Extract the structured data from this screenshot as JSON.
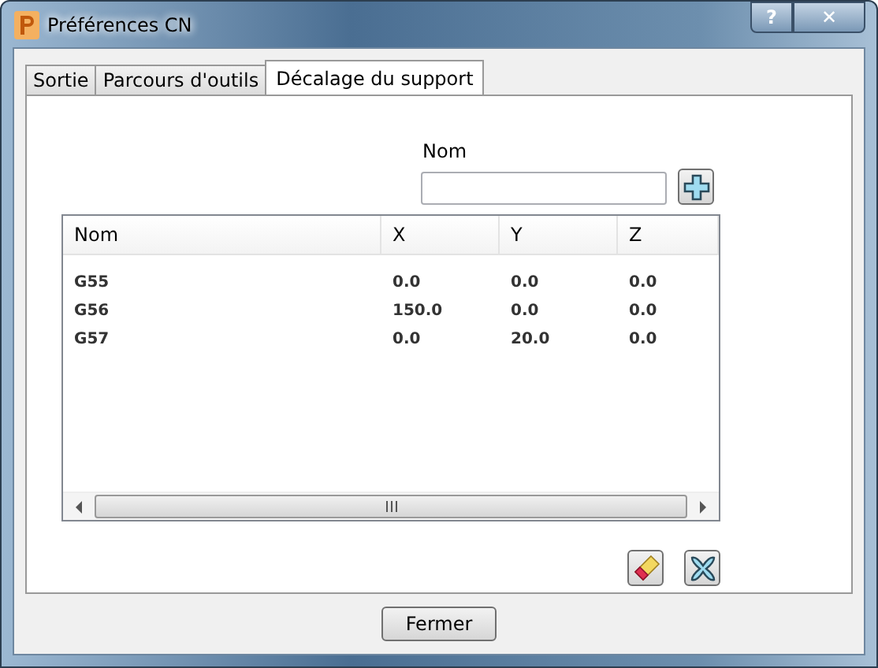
{
  "window": {
    "title": "Préférences CN",
    "help": "?",
    "close": "✕"
  },
  "tabs": [
    {
      "label": "Sortie",
      "selected": false
    },
    {
      "label": "Parcours d'outils",
      "selected": false
    },
    {
      "label": "Décalage du support",
      "selected": true
    }
  ],
  "name_field": {
    "label": "Nom"
  },
  "table": {
    "columns": [
      "Nom",
      "X",
      "Y",
      "Z"
    ],
    "rows": [
      [
        "G55",
        "0.0",
        "0.0",
        "0.0"
      ],
      [
        "G56",
        "150.0",
        "0.0",
        "0.0"
      ],
      [
        "G57",
        "0.0",
        "20.0",
        "0.0"
      ]
    ]
  },
  "close_button": "Fermer"
}
